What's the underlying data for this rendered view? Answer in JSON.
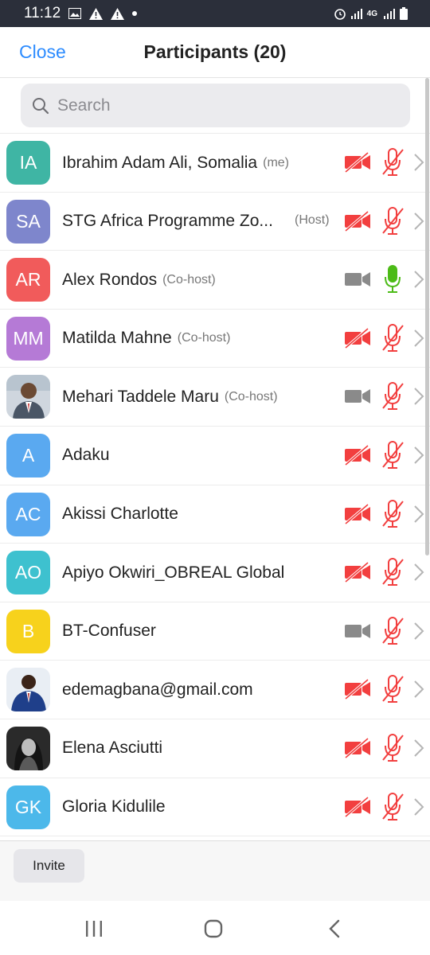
{
  "status_bar": {
    "time": "11:12",
    "network": "4G"
  },
  "header": {
    "close_label": "Close",
    "title": "Participants (20)"
  },
  "search": {
    "placeholder": "Search"
  },
  "colors": {
    "accent": "#2d8cff",
    "muted_red": "#f23f3f",
    "unmuted_green": "#4cbb17",
    "video_on_gray": "#8a8a8a"
  },
  "participants": [
    {
      "name": "Ibrahim Adam Ali, Somalia",
      "tag": "(me)",
      "initials": "IA",
      "avatar_color": "#3fb5a4",
      "video_muted": true,
      "mic_muted": true
    },
    {
      "name": "STG Africa Programme Zo...",
      "tag": "(Host)",
      "initials": "SA",
      "avatar_color": "#7e86cc",
      "video_muted": true,
      "mic_muted": true
    },
    {
      "name": "Alex Rondos",
      "tag": "(Co-host)",
      "initials": "AR",
      "avatar_color": "#f15b5b",
      "video_muted": false,
      "mic_muted": false
    },
    {
      "name": "Matilda Mahne",
      "tag": "(Co-host)",
      "initials": "MM",
      "avatar_color": "#b57ad6",
      "video_muted": true,
      "mic_muted": true
    },
    {
      "name": "Mehari Taddele Maru",
      "tag": "(Co-host)",
      "initials": "",
      "avatar_photo": "photo-suit",
      "video_muted": false,
      "mic_muted": true
    },
    {
      "name": "Adaku",
      "tag": "",
      "initials": "A",
      "avatar_color": "#5aa9f0",
      "video_muted": true,
      "mic_muted": true
    },
    {
      "name": "Akissi Charlotte",
      "tag": "",
      "initials": "AC",
      "avatar_color": "#5aa9f0",
      "video_muted": true,
      "mic_muted": true
    },
    {
      "name": "Apiyo Okwiri_OBREAL Global",
      "tag": "",
      "initials": "AO",
      "avatar_color": "#3ec1cf",
      "video_muted": true,
      "mic_muted": true
    },
    {
      "name": "BT-Confuser",
      "tag": "",
      "initials": "B",
      "avatar_color": "#f7d21c",
      "video_muted": false,
      "mic_muted": true
    },
    {
      "name": "edemagbana@gmail.com",
      "tag": "",
      "initials": "",
      "avatar_photo": "photo-blue-suit",
      "video_muted": true,
      "mic_muted": true
    },
    {
      "name": "Elena Asciutti",
      "tag": "",
      "initials": "",
      "avatar_photo": "photo-bw",
      "video_muted": true,
      "mic_muted": true
    },
    {
      "name": "Gloria Kidulile",
      "tag": "",
      "initials": "GK",
      "avatar_color": "#4cb8ea",
      "video_muted": true,
      "mic_muted": true
    }
  ],
  "footer": {
    "invite_label": "Invite"
  }
}
